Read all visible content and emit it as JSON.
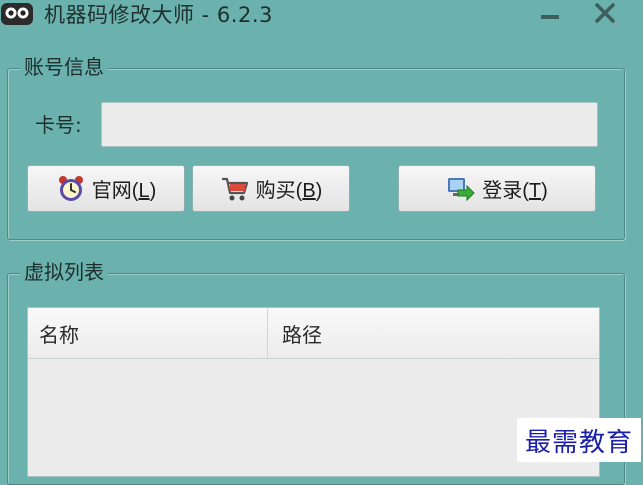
{
  "window": {
    "title": "机器码修改大师 - 6.2.3",
    "app_icon": "owl-face-icon",
    "controls": {
      "minimize_icon": "minimize-icon",
      "close_icon": "close-icon"
    }
  },
  "account_group": {
    "legend": "账号信息",
    "card_label": "卡号:",
    "card_value": "",
    "buttons": {
      "home": {
        "label": "官网",
        "accel_open": "(",
        "accel": "L",
        "accel_close": ")",
        "icon": "alarm-clock-icon"
      },
      "buy": {
        "label": "购买",
        "accel_open": "(",
        "accel": "B",
        "accel_close": ")",
        "icon": "shopping-cart-icon"
      },
      "login": {
        "label": "登录",
        "accel_open": "(",
        "accel": "T",
        "accel_close": ")",
        "icon": "login-monitor-arrow-icon"
      }
    }
  },
  "virtual_list_group": {
    "legend": "虚拟列表",
    "columns": [
      "名称",
      "路径"
    ],
    "rows": []
  },
  "watermark": "最需教育",
  "colors": {
    "window_background": "#6bb1ad",
    "watermark_text": "#1b1fa8"
  }
}
